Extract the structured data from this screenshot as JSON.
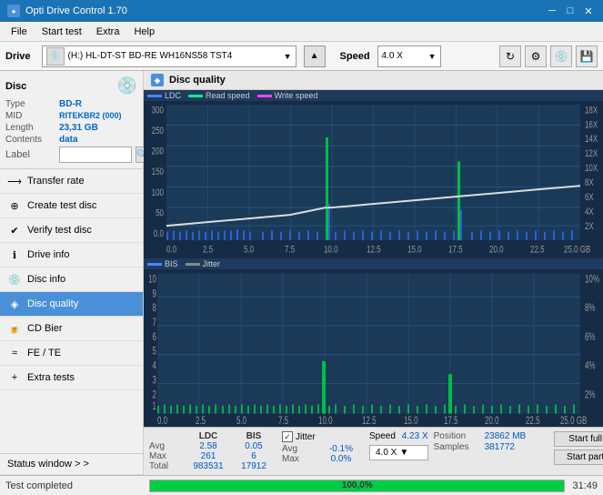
{
  "titlebar": {
    "title": "Opti Drive Control 1.70",
    "icon": "●",
    "minimize": "─",
    "maximize": "□",
    "close": "✕"
  },
  "menubar": {
    "items": [
      "File",
      "Start test",
      "Extra",
      "Help"
    ]
  },
  "drivebar": {
    "label": "Drive",
    "drive_display": "(H:)  HL-DT-ST BD-RE  WH16NS58 TST4",
    "speed_label": "Speed",
    "speed_value": "4.0 X",
    "eject_icon": "▲"
  },
  "sidebar": {
    "disc_section": {
      "title": "Disc",
      "type_key": "Type",
      "type_val": "BD-R",
      "mid_key": "MID",
      "mid_val": "RITEKBR2 (000)",
      "length_key": "Length",
      "length_val": "23,31 GB",
      "contents_key": "Contents",
      "contents_val": "data",
      "label_key": "Label"
    },
    "nav_items": [
      {
        "id": "transfer-rate",
        "label": "Transfer rate",
        "icon": "⟶"
      },
      {
        "id": "create-test-disc",
        "label": "Create test disc",
        "icon": "⊕"
      },
      {
        "id": "verify-test-disc",
        "label": "Verify test disc",
        "icon": "✔"
      },
      {
        "id": "drive-info",
        "label": "Drive info",
        "icon": "ℹ"
      },
      {
        "id": "disc-info",
        "label": "Disc info",
        "icon": "💿"
      },
      {
        "id": "disc-quality",
        "label": "Disc quality",
        "icon": "◈",
        "active": true
      },
      {
        "id": "cd-bier",
        "label": "CD Bier",
        "icon": "🍺"
      },
      {
        "id": "fe-te",
        "label": "FE / TE",
        "icon": "≈"
      },
      {
        "id": "extra-tests",
        "label": "Extra tests",
        "icon": "+"
      }
    ],
    "status_window": "Status window > >"
  },
  "content": {
    "title": "Disc quality",
    "chart1": {
      "legend": [
        {
          "label": "LDC",
          "color": "#4488ff"
        },
        {
          "label": "Read speed",
          "color": "#00ff88"
        },
        {
          "label": "Write speed",
          "color": "#ff44ff"
        }
      ],
      "y_labels_left": [
        "300",
        "250",
        "200",
        "150",
        "100",
        "50",
        "0.0"
      ],
      "y_labels_right": [
        "18X",
        "16X",
        "14X",
        "12X",
        "10X",
        "8X",
        "6X",
        "4X",
        "2X"
      ],
      "x_labels": [
        "0.0",
        "2.5",
        "5.0",
        "7.5",
        "10.0",
        "12.5",
        "15.0",
        "17.5",
        "20.0",
        "22.5",
        "25.0 GB"
      ]
    },
    "chart2": {
      "legend": [
        {
          "label": "BIS",
          "color": "#4488ff"
        },
        {
          "label": "Jitter",
          "color": "#888888"
        }
      ],
      "y_labels_left": [
        "10",
        "9",
        "8",
        "7",
        "6",
        "5",
        "4",
        "3",
        "2",
        "1"
      ],
      "y_labels_right": [
        "10%",
        "8%",
        "6%",
        "4%",
        "2%"
      ],
      "x_labels": [
        "0.0",
        "2.5",
        "5.0",
        "7.5",
        "10.0",
        "12.5",
        "15.0",
        "17.5",
        "20.0",
        "22.5",
        "25.0 GB"
      ]
    }
  },
  "stats": {
    "headers": [
      "LDC",
      "BIS",
      "",
      "Jitter",
      "Speed",
      ""
    ],
    "avg_label": "Avg",
    "avg_ldc": "2.58",
    "avg_bis": "0.05",
    "avg_jitter": "-0.1%",
    "max_label": "Max",
    "max_ldc": "261",
    "max_bis": "6",
    "max_jitter": "0.0%",
    "total_label": "Total",
    "total_ldc": "983531",
    "total_bis": "17912",
    "jitter_label": "Jitter",
    "speed_label": "Speed",
    "speed_val": "4.23 X",
    "speed_select": "4.0 X",
    "position_label": "Position",
    "position_val": "23862 MB",
    "samples_label": "Samples",
    "samples_val": "381772",
    "btn_start_full": "Start full",
    "btn_start_part": "Start part"
  },
  "statusbar": {
    "text": "Test completed",
    "progress": 100,
    "progress_text": "100,0%",
    "time": "31:49"
  }
}
